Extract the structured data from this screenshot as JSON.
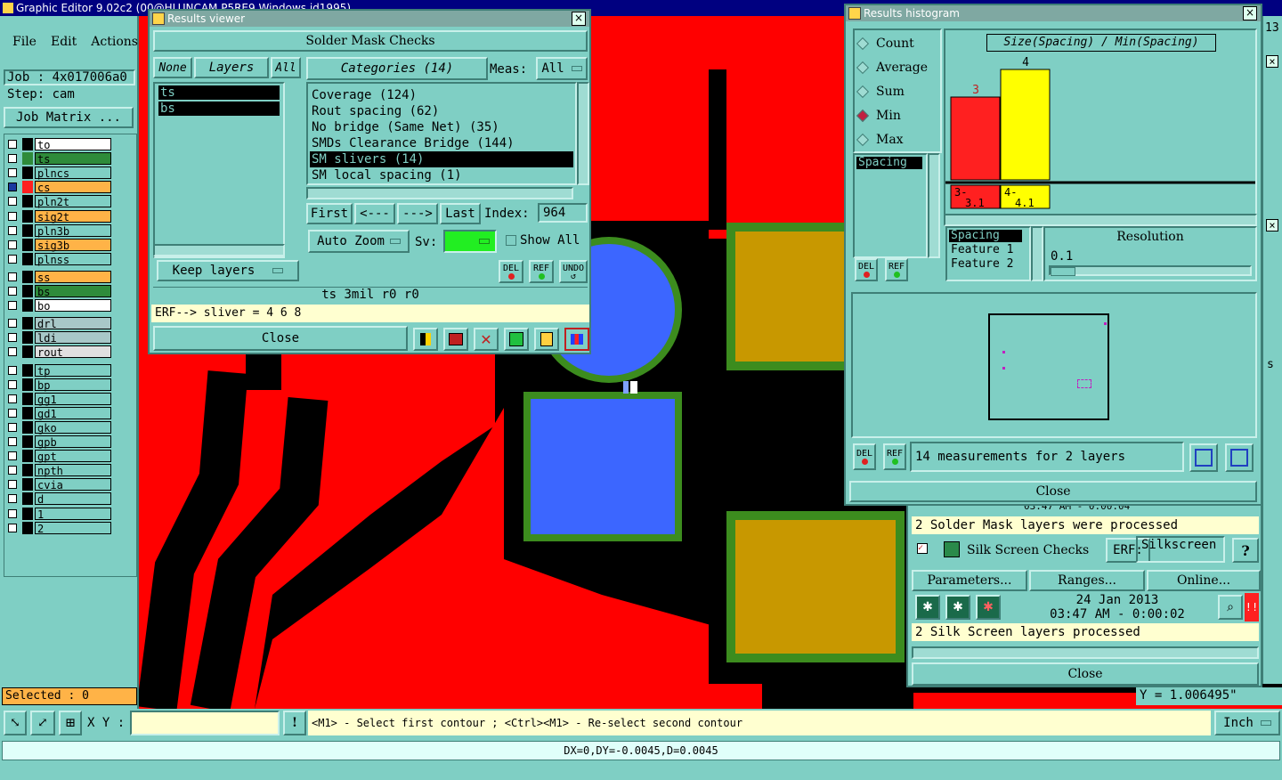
{
  "app": {
    "title": "Graphic Editor 9.02c2 (00@HLUNCAM P5RE9 Windows id1995)"
  },
  "menu": [
    "File",
    "Edit",
    "Actions"
  ],
  "job": {
    "job_label": "Job : 4x017006a0",
    "step_label": "Step: cam",
    "matrix_button": "Job Matrix ..."
  },
  "layers": [
    {
      "name": "to",
      "color": "#ffffff",
      "indicator": "#000000"
    },
    {
      "name": "ts",
      "color": "#2e8b3a",
      "indicator": "#2e8b3a"
    },
    {
      "name": "plncs",
      "color": "#7fcfc4",
      "indicator": "#000000"
    },
    {
      "name": "cs",
      "color": "#ffb347",
      "indicator": "#ff2020",
      "active": true
    },
    {
      "name": "pln2t",
      "color": "#7fcfc4",
      "indicator": "#000000"
    },
    {
      "name": "sig2t",
      "color": "#ffb347",
      "indicator": "#000000"
    },
    {
      "name": "pln3b",
      "color": "#7fcfc4",
      "indicator": "#000000"
    },
    {
      "name": "sig3b",
      "color": "#ffb347",
      "indicator": "#000000"
    },
    {
      "name": "plnss",
      "color": "#7fcfc4",
      "indicator": "#000000"
    },
    {
      "name": "ss",
      "color": "#ffb347",
      "indicator": "#000000"
    },
    {
      "name": "bs",
      "color": "#2e8b3a",
      "indicator": "#000000"
    },
    {
      "name": "bo",
      "color": "#ffffff",
      "indicator": "#000000"
    },
    {
      "name": "drl",
      "color": "#a8c8c8",
      "indicator": "#000000"
    },
    {
      "name": "ldi",
      "color": "#a8c8c8",
      "indicator": "#000000"
    },
    {
      "name": "rout",
      "color": "#e0e0e0",
      "indicator": "#000000"
    },
    {
      "name": "tp",
      "color": "#7fcfc4",
      "indicator": "#000000"
    },
    {
      "name": "bp",
      "color": "#7fcfc4",
      "indicator": "#000000"
    },
    {
      "name": "gg1",
      "color": "#7fcfc4",
      "indicator": "#000000"
    },
    {
      "name": "gd1",
      "color": "#7fcfc4",
      "indicator": "#000000"
    },
    {
      "name": "gko",
      "color": "#7fcfc4",
      "indicator": "#000000"
    },
    {
      "name": "gpb",
      "color": "#7fcfc4",
      "indicator": "#000000"
    },
    {
      "name": "gpt",
      "color": "#7fcfc4",
      "indicator": "#000000"
    },
    {
      "name": "npth",
      "color": "#7fcfc4",
      "indicator": "#000000"
    },
    {
      "name": "cvia",
      "color": "#7fcfc4",
      "indicator": "#000000"
    },
    {
      "name": "d",
      "color": "#7fcfc4",
      "indicator": "#000000"
    },
    {
      "name": "1",
      "color": "#7fcfc4",
      "indicator": "#000000"
    },
    {
      "name": "2",
      "color": "#7fcfc4",
      "indicator": "#000000"
    }
  ],
  "selected_label": "Selected : 0",
  "results_viewer": {
    "title": "Results viewer",
    "header": "Solder Mask Checks",
    "tabs": [
      "None",
      "Layers",
      "All"
    ],
    "layer_items": [
      "ts",
      "bs"
    ],
    "categories_label": "Categories (14)",
    "meas_label": "Meas:",
    "meas_value": "All",
    "categories": [
      "Coverage (124)",
      "Rout spacing (62)",
      "No bridge (Same Net) (35)",
      "SMDs Clearance Bridge (144)",
      "SM slivers (14)",
      "SM local spacing (1)"
    ],
    "selected_category": 4,
    "nav": [
      "First",
      "<---",
      "--->",
      "Last"
    ],
    "index_label": "Index:",
    "index_value": "964",
    "auto_zoom": "Auto Zoom",
    "sv_label": "Sv:",
    "show_all": "Show All",
    "keep_layers": "Keep layers",
    "del": "DEL",
    "ref": "REF",
    "undo": "UNDO",
    "info": "ts 3mil  r0  r0",
    "erf": "ERF--> sliver = 4 6 8",
    "close": "Close"
  },
  "histogram": {
    "title": "Results histogram",
    "modes": [
      "Count",
      "Average",
      "Sum",
      "Min",
      "Max"
    ],
    "selected_mode": "Min",
    "chart_title": "Size(Spacing) / Min(Spacing)",
    "bars": [
      {
        "value": 3,
        "color": "#ff2020",
        "range": "3- 3.1"
      },
      {
        "value": 4,
        "color": "#ffff00",
        "range": "4- 4.1"
      }
    ],
    "measure_list": [
      "Spacing"
    ],
    "feature_list": [
      "Spacing",
      "Feature 1",
      "Feature 2"
    ],
    "resolution_label": "Resolution",
    "resolution_value": "0.1",
    "summary": "14 measurements for 2 layers",
    "del": "DEL",
    "ref": "REF",
    "close": "Close"
  },
  "checklist": {
    "top_time": "03:47 AM - 0:00:04",
    "sm_processed": "2 Solder Mask layers were processed",
    "silk_label": "Silk Screen Checks",
    "erf_label": "ERF:",
    "erf_value": "Silkscreen",
    "help": "?",
    "buttons": [
      "Parameters...",
      "Ranges...",
      "Online..."
    ],
    "date": "24 Jan 2013",
    "time": "03:47 AM - 0:00:02",
    "silk_processed": "2 Silk Screen layers processed",
    "close": "Close"
  },
  "right_edge": {
    "num": "13",
    "s": "s"
  },
  "coords": {
    "y": "Y = 1.006495\""
  },
  "status": {
    "xy_label": "X Y :",
    "prompt": "<M1> - Select first contour ; <Ctrl><M1> - Re-select second contour",
    "unit": "Inch",
    "delta": "DX=0,DY=-0.0045,D=0.0045"
  }
}
